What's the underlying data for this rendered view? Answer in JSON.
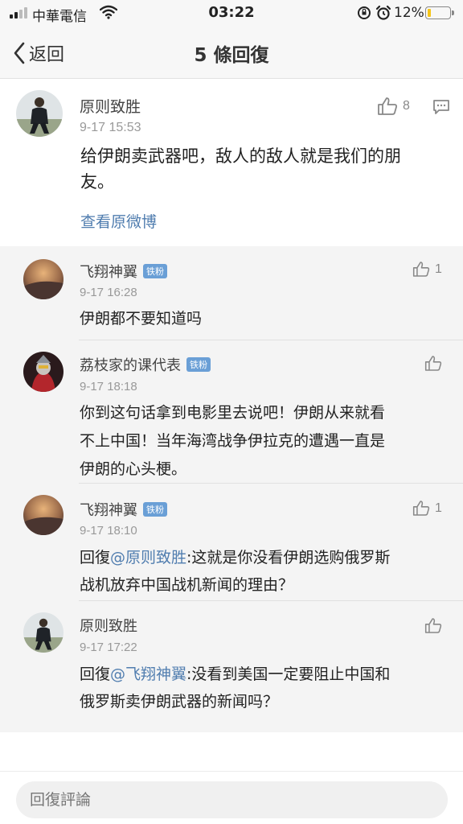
{
  "status_bar": {
    "carrier": "中華電信",
    "time": "03:22",
    "battery": "12%",
    "battery_level": 0.12
  },
  "nav": {
    "back_label": "返回",
    "title": "5 條回復"
  },
  "main_comment": {
    "username": "原则致胜",
    "timestamp": "9-17 15:53",
    "likes": "8",
    "text_line1": "给伊朗卖武器吧，敌人的敌人就是我们的朋",
    "text_line2": "友。",
    "view_original": "查看原微博"
  },
  "replies": [
    {
      "username": "飞翔神翼",
      "badge": "铁粉",
      "timestamp": "9-17 16:28",
      "likes": "1",
      "lines": [
        "伊朗都不要知道吗"
      ]
    },
    {
      "username": "荔枝家的课代表",
      "badge": "铁粉",
      "timestamp": "9-17 18:18",
      "likes": "",
      "lines": [
        "你到这句话拿到电影里去说吧！伊朗从来就看",
        "不上中国！当年海湾战争伊拉克的遭遇一直是",
        "伊朗的心头梗。"
      ]
    },
    {
      "username": "飞翔神翼",
      "badge": "铁粉",
      "timestamp": "9-17 18:10",
      "likes": "1",
      "reply_prefix": "回復",
      "mention": "@原则致胜",
      "line1_rest": ":这就是你没看伊朗选购俄罗斯",
      "line2": "战机放弃中国战机新闻的理由？"
    },
    {
      "username": "原则致胜",
      "timestamp": "9-17 17:22",
      "likes": "",
      "reply_prefix": "回復",
      "mention": "@飞翔神翼",
      "line1_rest": ":没看到美国一定要阻止中国和",
      "line2": "俄罗斯卖伊朗武器的新闻吗？"
    }
  ],
  "bottom": {
    "placeholder": "回復評論"
  },
  "colors": {
    "link": "#507daf",
    "badge": "#6a9fd6",
    "reply_bg": "#f4f4f4"
  },
  "icons": [
    "signal-icon",
    "wifi-icon",
    "orientation-lock-icon",
    "alarm-icon",
    "battery-icon",
    "back-chevron-icon",
    "thumbs-up-icon",
    "comment-icon"
  ]
}
